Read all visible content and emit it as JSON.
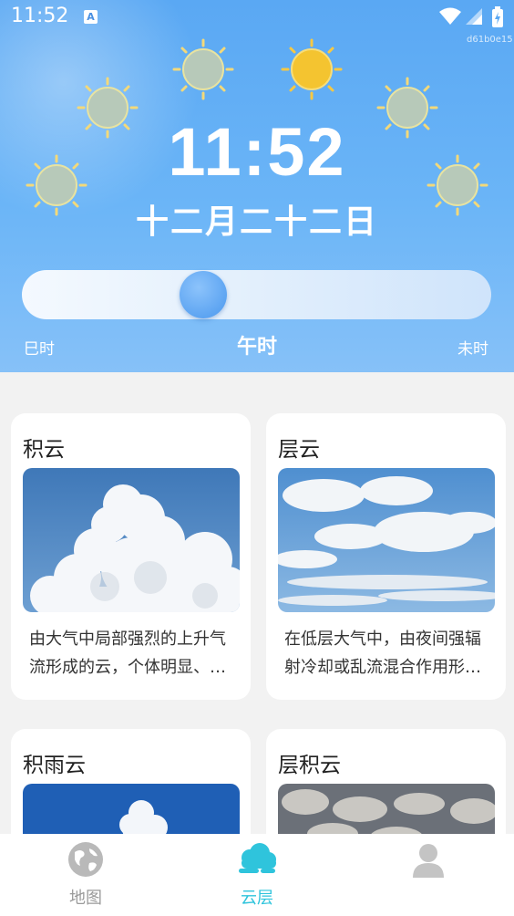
{
  "status_bar": {
    "time": "11:52",
    "notification_icon": "A",
    "device_tag": "d61b0e15"
  },
  "hero": {
    "time": "11:52",
    "lunar_date": "十二月二十二日",
    "hour_left": "巳时",
    "hour_current": "午时",
    "hour_right": "未时",
    "slider_position_fraction": 0.4,
    "colors": {
      "sky_top": "#5aa8f3",
      "sky_bottom": "#86c1f8",
      "active_sun": "#f4c430"
    }
  },
  "cards": [
    {
      "title": "积云",
      "description": "由大气中局部强烈的上升气流形成的云，个体明显、底部平坦、顶部凸起",
      "image": "cumulus-cloud-photo"
    },
    {
      "title": "层云",
      "description": "在低层大气中，由夜间强辐射冷却或乱流混合作用形成的云",
      "image": "stratus-cloud-photo"
    },
    {
      "title": "积雨云",
      "description": "",
      "image": "cumulonimbus-cloud-photo"
    },
    {
      "title": "层积云",
      "description": "",
      "image": "stratocumulus-cloud-photo"
    }
  ],
  "nav": {
    "items": [
      {
        "label": "地图",
        "icon": "globe-icon",
        "active": false
      },
      {
        "label": "云层",
        "icon": "cloud-icon",
        "active": true
      },
      {
        "label": "",
        "icon": "profile-icon",
        "active": false
      }
    ],
    "active_color": "#2fc4dc",
    "inactive_color": "#9a9a9a"
  }
}
